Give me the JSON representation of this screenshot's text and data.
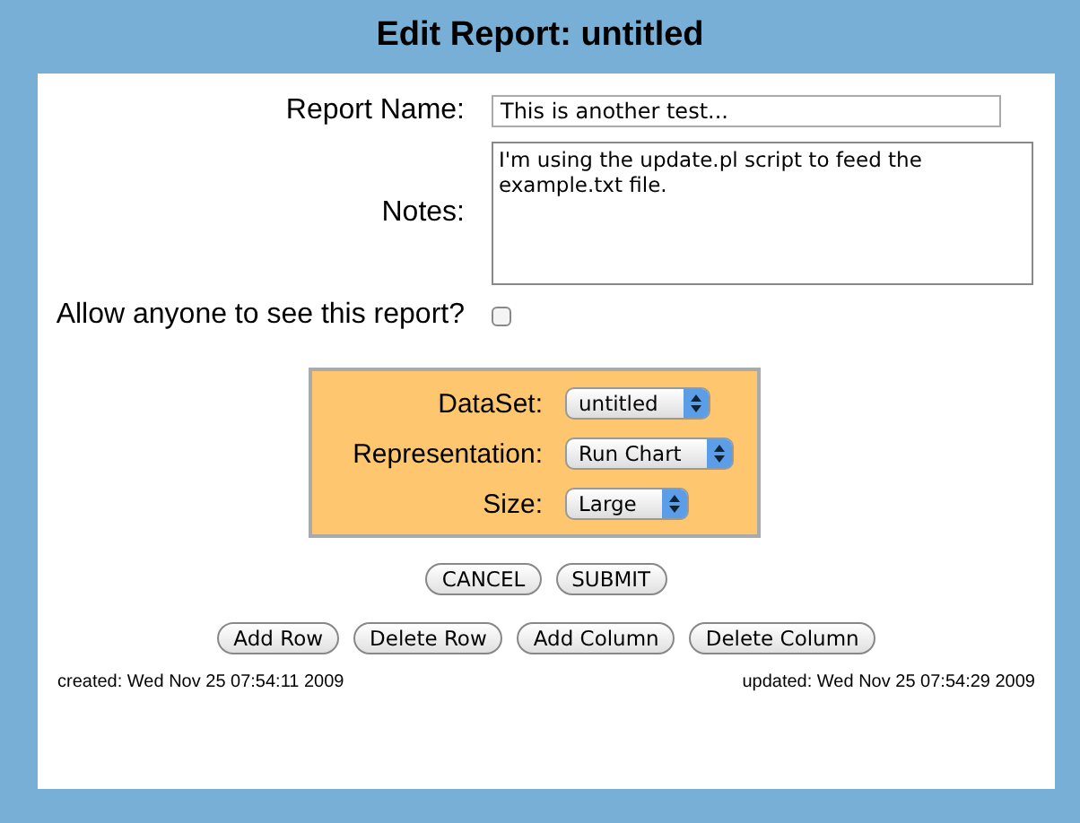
{
  "title": "Edit Report: untitled",
  "fields": [
    {
      "kind": "text",
      "label": "Report Name:",
      "value": "This is another test..."
    },
    {
      "kind": "textarea",
      "label": "Notes:",
      "value": "I'm using the update.pl script to feed the example.txt file."
    },
    {
      "kind": "checkbox",
      "label": "Allow anyone to see this report?",
      "checked": false
    }
  ],
  "options": [
    {
      "label": "DataSet:",
      "value": "untitled"
    },
    {
      "label": "Representation:",
      "value": "Run Chart"
    },
    {
      "label": "Size:",
      "value": "Large"
    }
  ],
  "form_buttons": [
    "CANCEL",
    "SUBMIT"
  ],
  "table_buttons": [
    "Add Row",
    "Delete Row",
    "Add Column",
    "Delete Column"
  ],
  "created": "created: Wed Nov 25 07:54:11 2009",
  "updated": "updated: Wed Nov 25 07:54:29 2009"
}
